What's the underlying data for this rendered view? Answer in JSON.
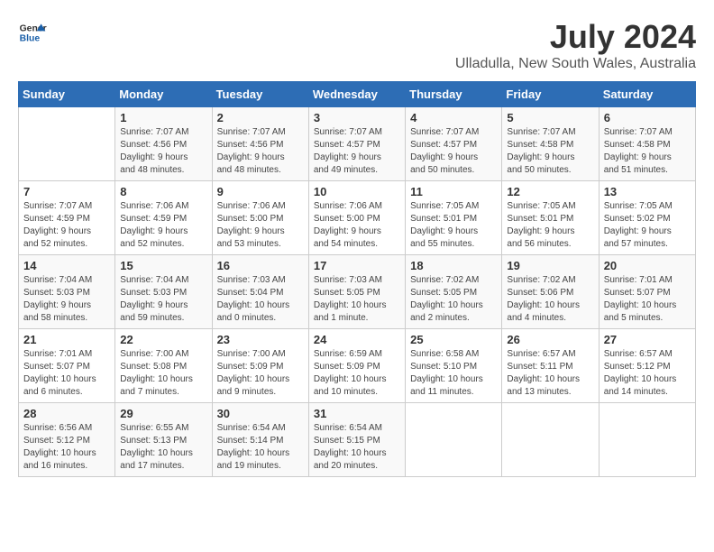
{
  "logo": {
    "line1": "General",
    "line2": "Blue"
  },
  "title": "July 2024",
  "location": "Ulladulla, New South Wales, Australia",
  "weekdays": [
    "Sunday",
    "Monday",
    "Tuesday",
    "Wednesday",
    "Thursday",
    "Friday",
    "Saturday"
  ],
  "weeks": [
    [
      {
        "day": "",
        "info": ""
      },
      {
        "day": "1",
        "info": "Sunrise: 7:07 AM\nSunset: 4:56 PM\nDaylight: 9 hours\nand 48 minutes."
      },
      {
        "day": "2",
        "info": "Sunrise: 7:07 AM\nSunset: 4:56 PM\nDaylight: 9 hours\nand 48 minutes."
      },
      {
        "day": "3",
        "info": "Sunrise: 7:07 AM\nSunset: 4:57 PM\nDaylight: 9 hours\nand 49 minutes."
      },
      {
        "day": "4",
        "info": "Sunrise: 7:07 AM\nSunset: 4:57 PM\nDaylight: 9 hours\nand 50 minutes."
      },
      {
        "day": "5",
        "info": "Sunrise: 7:07 AM\nSunset: 4:58 PM\nDaylight: 9 hours\nand 50 minutes."
      },
      {
        "day": "6",
        "info": "Sunrise: 7:07 AM\nSunset: 4:58 PM\nDaylight: 9 hours\nand 51 minutes."
      }
    ],
    [
      {
        "day": "7",
        "info": "Sunrise: 7:07 AM\nSunset: 4:59 PM\nDaylight: 9 hours\nand 52 minutes."
      },
      {
        "day": "8",
        "info": "Sunrise: 7:06 AM\nSunset: 4:59 PM\nDaylight: 9 hours\nand 52 minutes."
      },
      {
        "day": "9",
        "info": "Sunrise: 7:06 AM\nSunset: 5:00 PM\nDaylight: 9 hours\nand 53 minutes."
      },
      {
        "day": "10",
        "info": "Sunrise: 7:06 AM\nSunset: 5:00 PM\nDaylight: 9 hours\nand 54 minutes."
      },
      {
        "day": "11",
        "info": "Sunrise: 7:05 AM\nSunset: 5:01 PM\nDaylight: 9 hours\nand 55 minutes."
      },
      {
        "day": "12",
        "info": "Sunrise: 7:05 AM\nSunset: 5:01 PM\nDaylight: 9 hours\nand 56 minutes."
      },
      {
        "day": "13",
        "info": "Sunrise: 7:05 AM\nSunset: 5:02 PM\nDaylight: 9 hours\nand 57 minutes."
      }
    ],
    [
      {
        "day": "14",
        "info": "Sunrise: 7:04 AM\nSunset: 5:03 PM\nDaylight: 9 hours\nand 58 minutes."
      },
      {
        "day": "15",
        "info": "Sunrise: 7:04 AM\nSunset: 5:03 PM\nDaylight: 9 hours\nand 59 minutes."
      },
      {
        "day": "16",
        "info": "Sunrise: 7:03 AM\nSunset: 5:04 PM\nDaylight: 10 hours\nand 0 minutes."
      },
      {
        "day": "17",
        "info": "Sunrise: 7:03 AM\nSunset: 5:05 PM\nDaylight: 10 hours\nand 1 minute."
      },
      {
        "day": "18",
        "info": "Sunrise: 7:02 AM\nSunset: 5:05 PM\nDaylight: 10 hours\nand 2 minutes."
      },
      {
        "day": "19",
        "info": "Sunrise: 7:02 AM\nSunset: 5:06 PM\nDaylight: 10 hours\nand 4 minutes."
      },
      {
        "day": "20",
        "info": "Sunrise: 7:01 AM\nSunset: 5:07 PM\nDaylight: 10 hours\nand 5 minutes."
      }
    ],
    [
      {
        "day": "21",
        "info": "Sunrise: 7:01 AM\nSunset: 5:07 PM\nDaylight: 10 hours\nand 6 minutes."
      },
      {
        "day": "22",
        "info": "Sunrise: 7:00 AM\nSunset: 5:08 PM\nDaylight: 10 hours\nand 7 minutes."
      },
      {
        "day": "23",
        "info": "Sunrise: 7:00 AM\nSunset: 5:09 PM\nDaylight: 10 hours\nand 9 minutes."
      },
      {
        "day": "24",
        "info": "Sunrise: 6:59 AM\nSunset: 5:09 PM\nDaylight: 10 hours\nand 10 minutes."
      },
      {
        "day": "25",
        "info": "Sunrise: 6:58 AM\nSunset: 5:10 PM\nDaylight: 10 hours\nand 11 minutes."
      },
      {
        "day": "26",
        "info": "Sunrise: 6:57 AM\nSunset: 5:11 PM\nDaylight: 10 hours\nand 13 minutes."
      },
      {
        "day": "27",
        "info": "Sunrise: 6:57 AM\nSunset: 5:12 PM\nDaylight: 10 hours\nand 14 minutes."
      }
    ],
    [
      {
        "day": "28",
        "info": "Sunrise: 6:56 AM\nSunset: 5:12 PM\nDaylight: 10 hours\nand 16 minutes."
      },
      {
        "day": "29",
        "info": "Sunrise: 6:55 AM\nSunset: 5:13 PM\nDaylight: 10 hours\nand 17 minutes."
      },
      {
        "day": "30",
        "info": "Sunrise: 6:54 AM\nSunset: 5:14 PM\nDaylight: 10 hours\nand 19 minutes."
      },
      {
        "day": "31",
        "info": "Sunrise: 6:54 AM\nSunset: 5:15 PM\nDaylight: 10 hours\nand 20 minutes."
      },
      {
        "day": "",
        "info": ""
      },
      {
        "day": "",
        "info": ""
      },
      {
        "day": "",
        "info": ""
      }
    ]
  ]
}
